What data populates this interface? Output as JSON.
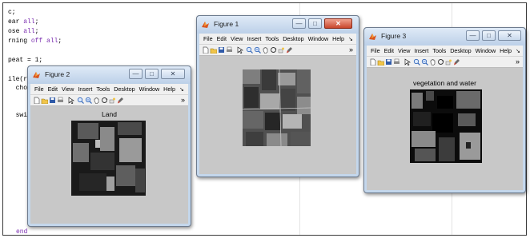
{
  "editor": {
    "lines": [
      {
        "plain": "c;",
        "kw": "",
        "rest": ""
      },
      {
        "plain": "ear ",
        "kw": "all",
        "rest": ";"
      },
      {
        "plain": "ose ",
        "kw": "all",
        "rest": ";"
      },
      {
        "plain": "rning ",
        "kw": "off all",
        "rest": ";"
      },
      {
        "plain": "peat = 1;",
        "kw": "",
        "rest": ""
      },
      {
        "plain": "ile(r",
        "kw": "",
        "rest": ""
      },
      {
        "plain": "  cho",
        "kw": "",
        "rest": ""
      },
      {
        "plain": "  swi",
        "kw": "",
        "rest": ""
      },
      {
        "plain": "end",
        "kw": "",
        "rest": ""
      }
    ]
  },
  "menu_labels": [
    "File",
    "Edit",
    "View",
    "Insert",
    "Tools",
    "Desktop",
    "Window",
    "Help"
  ],
  "menu_overflow": "↘",
  "toolbar_overflow": "»",
  "window_buttons": {
    "minimize": "—",
    "maximize": "□",
    "close": "✕"
  },
  "figures": {
    "figure1": {
      "title": "Figure 1",
      "axes_title": ""
    },
    "figure2": {
      "title": "Figure 2",
      "axes_title": "Land"
    },
    "figure3": {
      "title": "Figure 3",
      "axes_title": "vegetation and water"
    }
  },
  "icons": [
    "new-file-icon",
    "open-folder-icon",
    "save-icon",
    "print-icon",
    "pointer-icon",
    "zoom-in-icon",
    "zoom-out-icon",
    "pan-hand-icon",
    "rotate-3d-icon",
    "data-cursor-icon",
    "brush-icon"
  ],
  "colors": {
    "titlebar_top": "#dfeaf7",
    "titlebar_bottom": "#bcd0e8",
    "close_button": "#c9462c",
    "figure_background": "#c8c8c8",
    "keyword": "#7b2fb0"
  }
}
